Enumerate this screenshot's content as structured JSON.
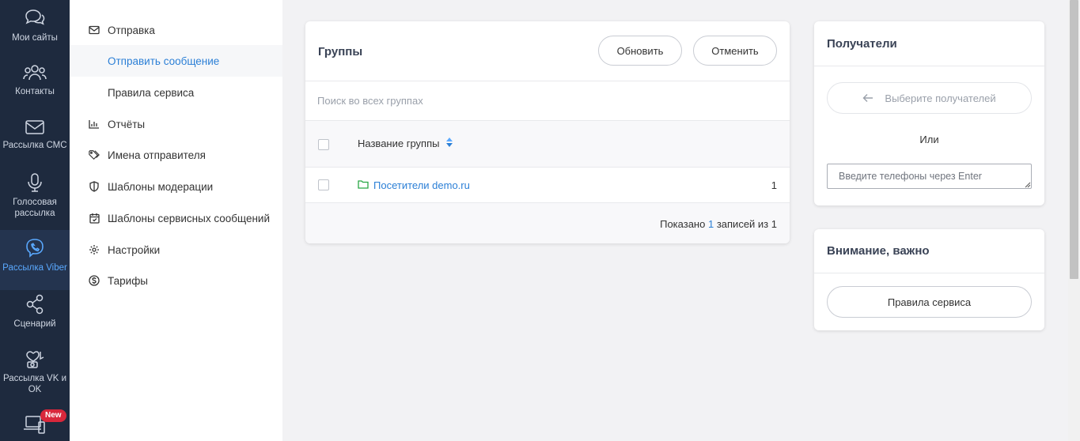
{
  "rail": {
    "items": [
      {
        "label": "Мои сайты",
        "icon": "chat-icon"
      },
      {
        "label": "Контакты",
        "icon": "contacts-icon"
      },
      {
        "label": "Рассылка СМС",
        "icon": "envelope-icon"
      },
      {
        "label": "Голосовая рассылка",
        "icon": "microphone-icon"
      },
      {
        "label": "Рассылка Viber",
        "icon": "viber-icon"
      },
      {
        "label": "Сценарий",
        "icon": "share-nodes-icon"
      },
      {
        "label": "Рассылка VK и OK",
        "icon": "social-icon"
      },
      {
        "label": "",
        "icon": "devices-icon"
      }
    ],
    "active_index": 4,
    "badge": "New"
  },
  "submenu": {
    "items": [
      {
        "label": "Отправка",
        "icon": "envelope-icon"
      },
      {
        "label": "Отправить сообщение",
        "icon": ""
      },
      {
        "label": "Правила сервиса",
        "icon": ""
      },
      {
        "label": "Отчёты",
        "icon": "bar-chart-icon"
      },
      {
        "label": "Имена отправителя",
        "icon": "tag-icon"
      },
      {
        "label": "Шаблоны модерации",
        "icon": "shield-icon"
      },
      {
        "label": "Шаблоны сервисных сообщений",
        "icon": "calendar-icon"
      },
      {
        "label": "Настройки",
        "icon": "gear-icon"
      },
      {
        "label": "Тарифы",
        "icon": "dollar-icon"
      }
    ],
    "active_index": 1
  },
  "groups": {
    "title": "Группы",
    "refresh_label": "Обновить",
    "cancel_label": "Отменить",
    "search_placeholder": "Поиск во всех группах",
    "column_name": "Название группы",
    "rows": [
      {
        "name": "Посетители demo.ru",
        "count": "1"
      }
    ],
    "footer": {
      "prefix": "Показано",
      "shown": "1",
      "suffix": "записей из 1"
    }
  },
  "recipients": {
    "title": "Получатели",
    "choose_label": "Выберите получателей",
    "or_label": "Или",
    "phones_placeholder": "Введите телефоны через Enter"
  },
  "attention": {
    "title": "Внимание, важно",
    "rules_button": "Правила сервиса"
  },
  "colors": {
    "rail_bg": "#1e2a3e",
    "accent": "#2b7fd6",
    "badge": "#d8273b",
    "folder": "#28a745"
  }
}
